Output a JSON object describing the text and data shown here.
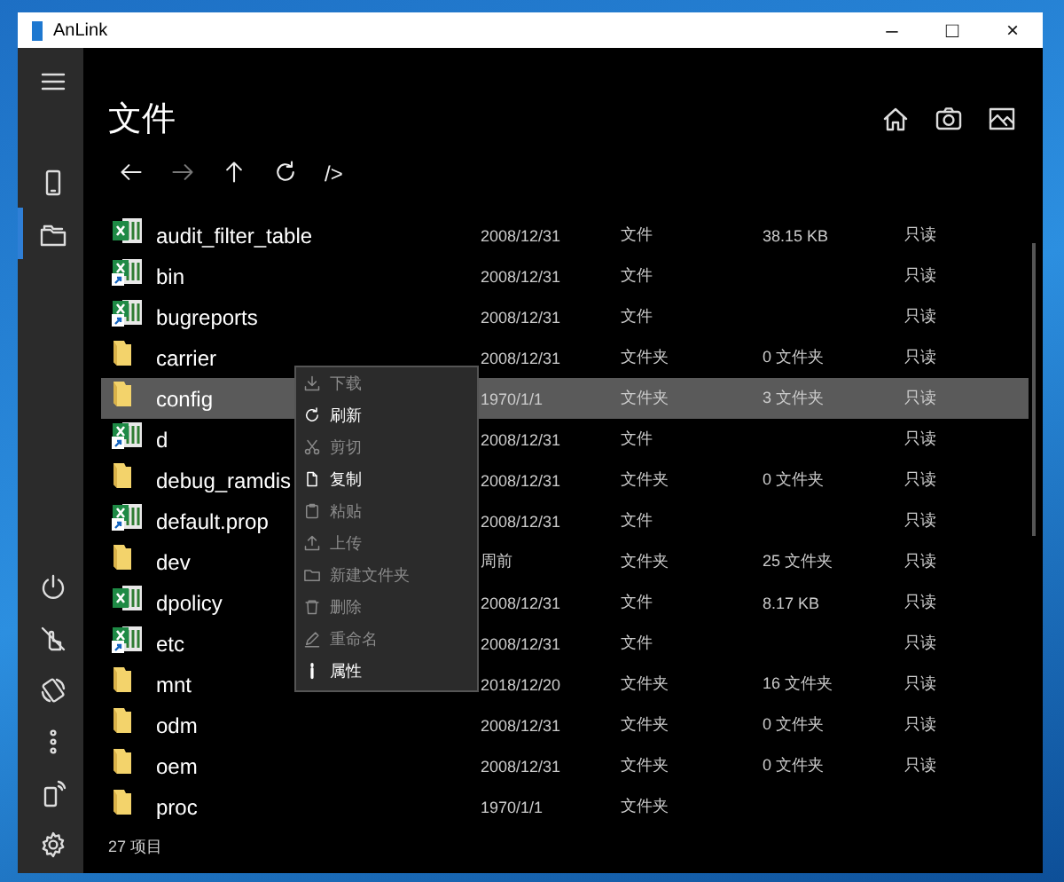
{
  "window": {
    "title": "AnLink",
    "controls": [
      "–",
      "□",
      "×"
    ]
  },
  "rail": {
    "top": [
      {
        "kind": "menu",
        "selected": false
      },
      {
        "kind": "phone",
        "selected": false
      },
      {
        "kind": "files",
        "selected": true
      }
    ],
    "bottom": [
      {
        "kind": "power",
        "selected": false
      },
      {
        "kind": "no-touch",
        "selected": false
      },
      {
        "kind": "rotate",
        "selected": false
      },
      {
        "kind": "more",
        "selected": false
      },
      {
        "kind": "phone-signal",
        "selected": false
      },
      {
        "kind": "settings",
        "selected": false
      }
    ]
  },
  "page_title": "文件",
  "header_actions": [
    {
      "kind": "home"
    },
    {
      "kind": "camera"
    },
    {
      "kind": "image"
    }
  ],
  "nav_buttons": [
    {
      "kind": "back",
      "disabled": false
    },
    {
      "kind": "forward",
      "disabled": true
    },
    {
      "kind": "up",
      "disabled": false
    },
    {
      "kind": "refresh",
      "disabled": false
    }
  ],
  "path": "/>",
  "files": [
    {
      "kind": "file",
      "name": "audit_filter_table",
      "date": "2008/12/31",
      "type": "文件",
      "size": "38.15 KB",
      "permission": "只读",
      "selected": false
    },
    {
      "kind": "file-link",
      "name": "bin",
      "date": "2008/12/31",
      "type": "文件",
      "permission": "只读",
      "selected": false
    },
    {
      "kind": "file-link",
      "name": "bugreports",
      "date": "2008/12/31",
      "type": "文件",
      "permission": "只读",
      "selected": false
    },
    {
      "kind": "folder",
      "name": "carrier",
      "date": "2008/12/31",
      "type": "文件夹",
      "size": "0 文件夹",
      "permission": "只读",
      "selected": false
    },
    {
      "kind": "folder",
      "name": "config",
      "date": "1970/1/1",
      "type": "文件夹",
      "size": "3 文件夹",
      "permission": "只读",
      "selected": true
    },
    {
      "kind": "file-link",
      "name": "d",
      "date": "2008/12/31",
      "type": "文件",
      "permission": "只读",
      "selected": false
    },
    {
      "kind": "folder",
      "name": "debug_ramdis",
      "date": "2008/12/31",
      "type": "文件夹",
      "size": "0 文件夹",
      "permission": "只读",
      "selected": false
    },
    {
      "kind": "file-link",
      "name": "default.prop",
      "date": "2008/12/31",
      "type": "文件",
      "permission": "只读",
      "selected": false
    },
    {
      "kind": "folder",
      "name": "dev",
      "date": "周前",
      "type": "文件夹",
      "size": "25 文件夹",
      "permission": "只读",
      "selected": false
    },
    {
      "kind": "file",
      "name": "dpolicy",
      "date": "2008/12/31",
      "type": "文件",
      "size": "8.17 KB",
      "permission": "只读",
      "selected": false
    },
    {
      "kind": "file-link",
      "name": "etc",
      "date": "2008/12/31",
      "type": "文件",
      "permission": "只读",
      "selected": false
    },
    {
      "kind": "folder",
      "name": "mnt",
      "date": "2018/12/20",
      "type": "文件夹",
      "size": "16 文件夹",
      "permission": "只读",
      "selected": false
    },
    {
      "kind": "folder",
      "name": "odm",
      "date": "2008/12/31",
      "type": "文件夹",
      "size": "0 文件夹",
      "permission": "只读",
      "selected": false
    },
    {
      "kind": "folder",
      "name": "oem",
      "date": "2008/12/31",
      "type": "文件夹",
      "size": "0 文件夹",
      "permission": "只读",
      "selected": false
    },
    {
      "kind": "folder",
      "name": "proc",
      "date": "1970/1/1",
      "type": "文件夹",
      "selected": false
    }
  ],
  "context_menu": [
    {
      "kind": "download",
      "label": "下载",
      "disabled": true
    },
    {
      "kind": "refresh",
      "label": "刷新",
      "disabled": false
    },
    {
      "kind": "cut",
      "label": "剪切",
      "disabled": true
    },
    {
      "kind": "copy",
      "label": "复制",
      "disabled": false
    },
    {
      "kind": "paste",
      "label": "粘贴",
      "disabled": true
    },
    {
      "kind": "upload",
      "label": "上传",
      "disabled": true
    },
    {
      "kind": "new-folder",
      "label": "新建文件夹",
      "disabled": true
    },
    {
      "kind": "delete",
      "label": "删除",
      "disabled": true
    },
    {
      "kind": "rename",
      "label": "重命名",
      "disabled": true
    },
    {
      "kind": "properties",
      "label": "属性",
      "disabled": false
    }
  ],
  "status": "27 项目"
}
